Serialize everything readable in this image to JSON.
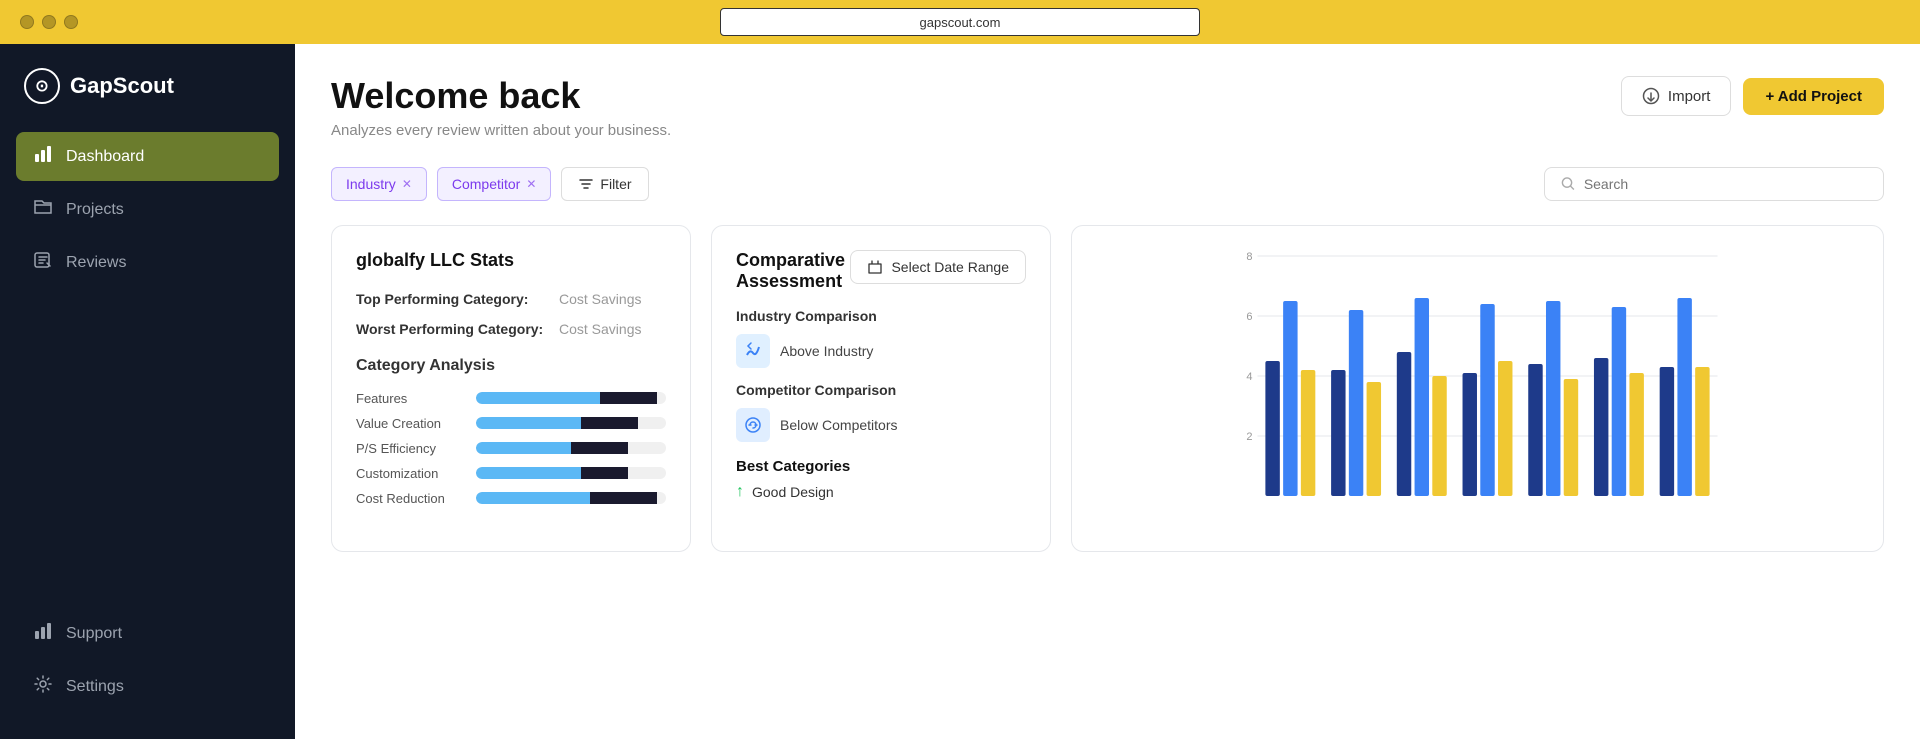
{
  "browser": {
    "url": "gapscout.com"
  },
  "sidebar": {
    "logo": {
      "icon": "⊙",
      "text": "GapScout"
    },
    "nav_items": [
      {
        "id": "dashboard",
        "label": "Dashboard",
        "icon": "▐▌",
        "active": true
      },
      {
        "id": "projects",
        "label": "Projects",
        "icon": "◈",
        "active": false
      },
      {
        "id": "reviews",
        "label": "Reviews",
        "icon": "☑",
        "active": false
      }
    ],
    "bottom_items": [
      {
        "id": "support",
        "label": "Support",
        "icon": "▐▌"
      },
      {
        "id": "settings",
        "label": "Settings",
        "icon": "⚙"
      }
    ]
  },
  "header": {
    "title": "Welcome back",
    "subtitle": "Analyzes every review written about your business.",
    "import_label": "Import",
    "add_project_label": "+ Add Project"
  },
  "filters": {
    "tags": [
      {
        "id": "industry",
        "label": "Industry"
      },
      {
        "id": "competitor",
        "label": "Competitor"
      }
    ],
    "filter_label": "Filter",
    "search_placeholder": "Search"
  },
  "stats_card": {
    "title": "globalfy LLC Stats",
    "top_label": "Top Performing Category:",
    "top_value": "Cost Savings",
    "worst_label": "Worst Performing Category:",
    "worst_value": "Cost Savings",
    "category_analysis_title": "Category Analysis",
    "categories": [
      {
        "label": "Features",
        "blue_pct": 65,
        "dark_pct": 30
      },
      {
        "label": "Value Creation",
        "blue_pct": 55,
        "dark_pct": 30
      },
      {
        "label": "P/S Efficiency",
        "blue_pct": 50,
        "dark_pct": 30
      },
      {
        "label": "Customization",
        "blue_pct": 55,
        "dark_pct": 25
      },
      {
        "label": "Cost Reduction",
        "blue_pct": 60,
        "dark_pct": 35
      }
    ]
  },
  "assessment_card": {
    "title": "Comparative Assessment",
    "date_range_label": "Select Date Range",
    "industry_comparison_label": "Industry Comparison",
    "industry_status": "Above Industry",
    "competitor_comparison_label": "Competitor Comparison",
    "competitor_status": "Below Competitors",
    "best_categories_title": "Best Categories",
    "best_category": "Good Design"
  },
  "chart": {
    "y_labels": [
      "2",
      "4",
      "6",
      "8"
    ],
    "bars": [
      {
        "navy": 4.5,
        "blue": 6.5,
        "gold": 4.2
      },
      {
        "navy": 4.2,
        "blue": 6.2,
        "gold": 3.8
      },
      {
        "navy": 4.8,
        "blue": 6.6,
        "gold": 4.0
      },
      {
        "navy": 4.1,
        "blue": 6.4,
        "gold": 4.5
      },
      {
        "navy": 4.4,
        "blue": 6.5,
        "gold": 3.9
      },
      {
        "navy": 4.6,
        "blue": 6.3,
        "gold": 4.1
      },
      {
        "navy": 4.3,
        "blue": 6.6,
        "gold": 4.3
      }
    ],
    "colors": {
      "navy": "#1e3a8a",
      "blue": "#3b82f6",
      "gold": "#f0c832"
    }
  }
}
